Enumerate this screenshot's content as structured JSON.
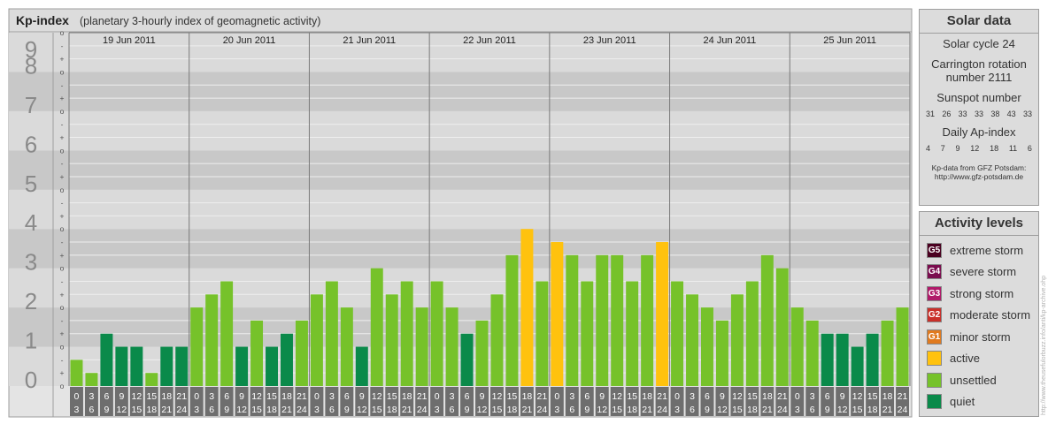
{
  "header": {
    "title": "Kp-index",
    "subtitle": "(planetary 3-hourly index of geomagnetic activity)"
  },
  "chart_data": {
    "type": "bar",
    "title": "Kp-index",
    "subtitle": "(planetary 3-hourly index of geomagnetic activity)",
    "ylim": [
      0,
      9
    ],
    "y_ticks": [
      "0",
      "1",
      "2",
      "3",
      "4",
      "5",
      "6",
      "7",
      "8",
      "9"
    ],
    "sub_ticks": [
      "o",
      "+",
      "-",
      "o"
    ],
    "days": [
      "19 Jun 2011",
      "20 Jun 2011",
      "21 Jun 2011",
      "22 Jun 2011",
      "23 Jun 2011",
      "24 Jun 2011",
      "25 Jun 2011"
    ],
    "interval_starts": [
      "0",
      "3",
      "6",
      "9",
      "12",
      "15",
      "18",
      "21"
    ],
    "interval_ends": [
      "3",
      "6",
      "9",
      "12",
      "15",
      "18",
      "21",
      "24"
    ],
    "values": [
      [
        0.667,
        0.333,
        1.333,
        1.0,
        1.0,
        0.333,
        1.0,
        1.0
      ],
      [
        2.0,
        2.333,
        2.667,
        1.0,
        1.667,
        1.0,
        1.333,
        1.667
      ],
      [
        2.333,
        2.667,
        2.0,
        1.0,
        3.0,
        2.333,
        2.667,
        2.0
      ],
      [
        2.667,
        2.0,
        1.333,
        1.667,
        2.333,
        3.333,
        4.0,
        2.667
      ],
      [
        3.667,
        3.333,
        2.667,
        3.333,
        3.333,
        2.667,
        3.333,
        3.667
      ],
      [
        2.667,
        2.333,
        2.0,
        1.667,
        2.333,
        2.667,
        3.333,
        3.0
      ],
      [
        2.0,
        1.667,
        1.333,
        1.333,
        1.0,
        1.333,
        1.667,
        2.0
      ]
    ],
    "levels": [
      [
        1,
        1,
        0,
        0,
        0,
        1,
        0,
        0
      ],
      [
        1,
        1,
        1,
        0,
        1,
        0,
        0,
        1
      ],
      [
        1,
        1,
        1,
        0,
        1,
        1,
        1,
        1
      ],
      [
        1,
        1,
        0,
        1,
        1,
        1,
        2,
        1
      ],
      [
        2,
        1,
        1,
        1,
        1,
        1,
        1,
        2
      ],
      [
        1,
        1,
        1,
        1,
        1,
        1,
        1,
        1
      ],
      [
        1,
        1,
        0,
        0,
        0,
        0,
        1,
        1
      ]
    ],
    "colors": {
      "quiet": "#0a8a4a",
      "unsettled": "#76c22a",
      "active": "#ffc20e",
      "minor": "#e07a1f",
      "moderate": "#c9302a",
      "strong": "#b0196a",
      "severe": "#7a0c4e",
      "extreme": "#4a0020"
    }
  },
  "solar": {
    "title": "Solar data",
    "cycle": "Solar cycle 24",
    "carrington_1": "Carrington rotation",
    "carrington_2": "number 2111",
    "sunspot_title": "Sunspot number",
    "sunspot_values": [
      "31",
      "26",
      "33",
      "33",
      "38",
      "43",
      "33"
    ],
    "ap_title": "Daily Ap-index",
    "ap_values": [
      "4",
      "7",
      "9",
      "12",
      "18",
      "11",
      "6"
    ],
    "source_1": "Kp-data from GFZ Potsdam:",
    "source_2": "http://www.gfz-potsdam.de"
  },
  "activity": {
    "title": "Activity levels",
    "items": [
      {
        "code": "G5",
        "label": "extreme storm",
        "color": "#4a0020"
      },
      {
        "code": "G4",
        "label": "severe storm",
        "color": "#7a0c4e"
      },
      {
        "code": "G3",
        "label": "strong storm",
        "color": "#b0196a"
      },
      {
        "code": "G2",
        "label": "moderate storm",
        "color": "#c9302a"
      },
      {
        "code": "G1",
        "label": "minor storm",
        "color": "#e07a1f"
      },
      {
        "code": "",
        "label": "active",
        "color": "#ffc20e"
      },
      {
        "code": "",
        "label": "unsettled",
        "color": "#76c22a"
      },
      {
        "code": "",
        "label": "quiet",
        "color": "#0a8a4a"
      }
    ]
  },
  "watermark": "http://www.theusefulorbuzz.info/anti/kp-archive.ohp"
}
